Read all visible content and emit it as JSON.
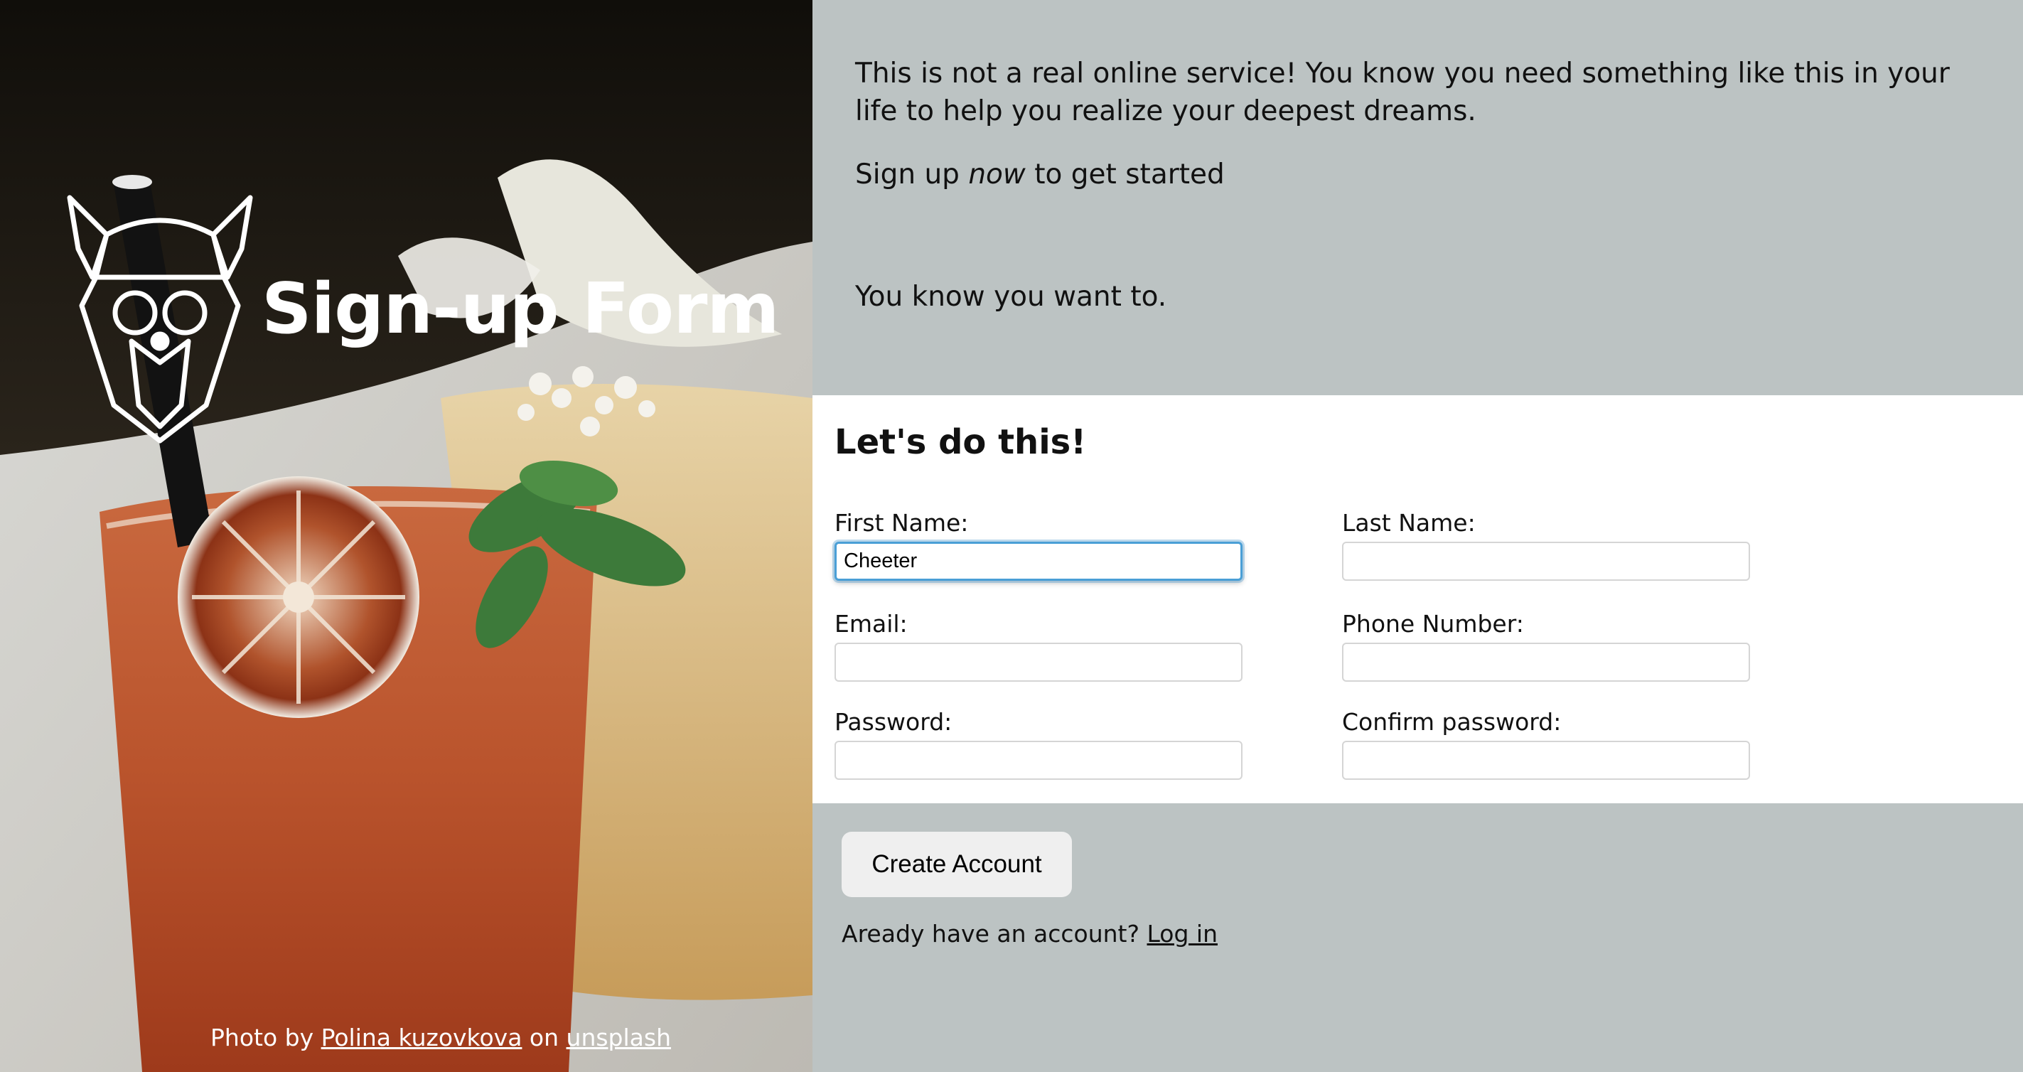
{
  "hero": {
    "title": "Sign-up Form",
    "logo_icon": "viking-helmet-logo-icon",
    "credit_prefix": "Photo by",
    "credit_author": "Polina kuzovkova",
    "credit_middle": "on",
    "credit_site": "unsplash"
  },
  "intro": {
    "paragraph1": "This is not a real online service! You know you need something like this in your life to help you realize your deepest dreams.",
    "signup_before": "Sign up",
    "signup_emphasis": "now",
    "signup_after": "to get started",
    "paragraph3": "You know you want to."
  },
  "form": {
    "title": "Let's do this!",
    "first_name": {
      "label": "First Name:",
      "value": "Cheeter"
    },
    "last_name": {
      "label": "Last Name:",
      "value": ""
    },
    "email": {
      "label": "Email:",
      "value": ""
    },
    "phone": {
      "label": "Phone Number:",
      "value": ""
    },
    "password": {
      "label": "Password:",
      "value": ""
    },
    "confirm_password": {
      "label": "Confirm password:",
      "value": ""
    }
  },
  "actions": {
    "create_account": "Create Account",
    "login_prompt": "Aready have an account?",
    "login_link": "Log in"
  },
  "colors": {
    "panel_gray": "#bcc3c3",
    "form_bg": "#ffffff",
    "focus_blue": "#4a9fd6",
    "button_bg": "#efefef"
  }
}
